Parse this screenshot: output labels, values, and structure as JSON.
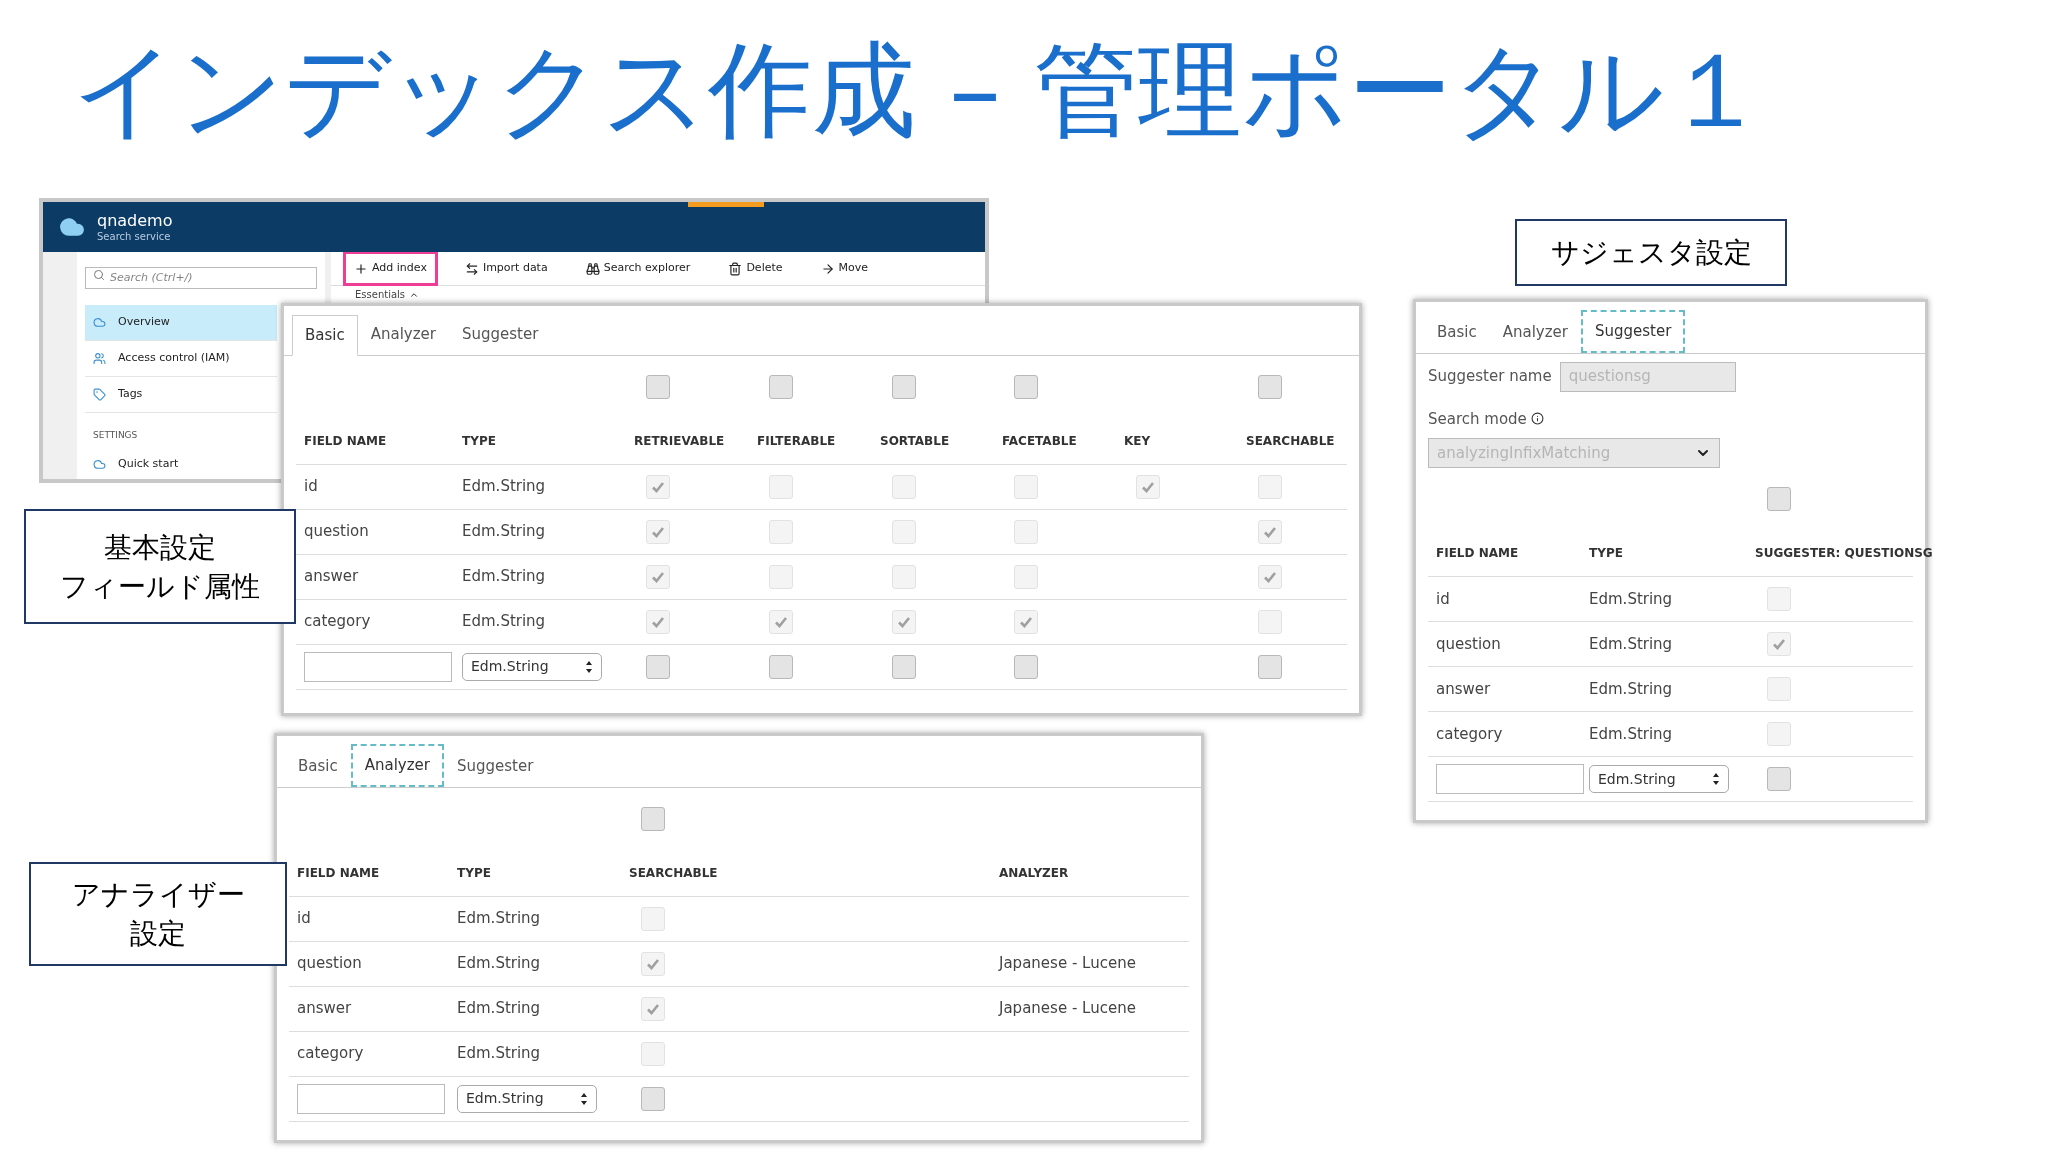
{
  "title": "インデックス作成 – 管理ポータル１",
  "portal": {
    "service_name": "qnademo",
    "service_type": "Search service",
    "search": {
      "placeholder": "Search (Ctrl+/)"
    },
    "busy": true,
    "sidebar": {
      "items": [
        {
          "label": "Overview",
          "selected": true
        },
        {
          "label": "Access control (IAM)",
          "selected": false
        },
        {
          "label": "Tags",
          "selected": false
        }
      ],
      "section": "SETTINGS",
      "section_items": [
        {
          "label": "Quick start",
          "selected": false
        }
      ]
    },
    "toolbar": [
      {
        "label": "Add index",
        "highlighted": true
      },
      {
        "label": "Import data",
        "highlighted": false
      },
      {
        "label": "Search explorer",
        "highlighted": false
      },
      {
        "label": "Delete",
        "highlighted": false
      },
      {
        "label": "Move",
        "highlighted": false
      }
    ],
    "essentials": "Essentials"
  },
  "callouts": [
    {
      "lines": [
        "基本設定",
        "フィールド属性"
      ]
    },
    {
      "lines": [
        "アナライザー",
        "設定"
      ]
    },
    {
      "lines": [
        "サジェスタ設定"
      ]
    }
  ],
  "panels": [
    {
      "kind": "basic",
      "tabs": [
        {
          "label": "Basic",
          "selected": true,
          "focus_ring": false
        },
        {
          "label": "Analyzer",
          "selected": false,
          "focus_ring": false
        },
        {
          "label": "Suggester",
          "selected": false,
          "focus_ring": false
        }
      ],
      "columns": [
        {
          "label": "FIELD NAME"
        },
        {
          "label": "TYPE"
        },
        {
          "label": "RETRIEVABLE",
          "select_all": {
            "checked": false
          }
        },
        {
          "label": "FILTERABLE",
          "select_all": {
            "checked": false
          }
        },
        {
          "label": "SORTABLE",
          "select_all": {
            "checked": false
          }
        },
        {
          "label": "FACETABLE",
          "select_all": {
            "checked": false
          }
        },
        {
          "label": "KEY"
        },
        {
          "label": "SEARCHABLE",
          "select_all": {
            "checked": false
          }
        }
      ],
      "rows": [
        [
          {
            "kind": "text",
            "text": "id"
          },
          {
            "kind": "text",
            "text": "Edm.String"
          },
          {
            "kind": "check",
            "checked": true,
            "disabled": true
          },
          {
            "kind": "check",
            "checked": false,
            "disabled": true
          },
          {
            "kind": "check",
            "checked": false,
            "disabled": true
          },
          {
            "kind": "check",
            "checked": false,
            "disabled": true
          },
          {
            "kind": "check",
            "checked": true,
            "disabled": true
          },
          {
            "kind": "check",
            "checked": false,
            "disabled": true
          }
        ],
        [
          {
            "kind": "text",
            "text": "question"
          },
          {
            "kind": "text",
            "text": "Edm.String"
          },
          {
            "kind": "check",
            "checked": true,
            "disabled": true
          },
          {
            "kind": "check",
            "checked": false,
            "disabled": true
          },
          {
            "kind": "check",
            "checked": false,
            "disabled": true
          },
          {
            "kind": "check",
            "checked": false,
            "disabled": true
          },
          null,
          {
            "kind": "check",
            "checked": true,
            "disabled": true
          }
        ],
        [
          {
            "kind": "text",
            "text": "answer"
          },
          {
            "kind": "text",
            "text": "Edm.String"
          },
          {
            "kind": "check",
            "checked": true,
            "disabled": true
          },
          {
            "kind": "check",
            "checked": false,
            "disabled": true
          },
          {
            "kind": "check",
            "checked": false,
            "disabled": true
          },
          {
            "kind": "check",
            "checked": false,
            "disabled": true
          },
          null,
          {
            "kind": "check",
            "checked": true,
            "disabled": true
          }
        ],
        [
          {
            "kind": "text",
            "text": "category"
          },
          {
            "kind": "text",
            "text": "Edm.String"
          },
          {
            "kind": "check",
            "checked": true,
            "disabled": true
          },
          {
            "kind": "check",
            "checked": true,
            "disabled": true
          },
          {
            "kind": "check",
            "checked": true,
            "disabled": true
          },
          {
            "kind": "check",
            "checked": true,
            "disabled": true
          },
          null,
          {
            "kind": "check",
            "checked": false,
            "disabled": true
          }
        ],
        [
          {
            "kind": "input"
          },
          {
            "kind": "select",
            "value": "Edm.String"
          },
          {
            "kind": "check",
            "checked": false,
            "disabled": false
          },
          {
            "kind": "check",
            "checked": false,
            "disabled": false
          },
          {
            "kind": "check",
            "checked": false,
            "disabled": false
          },
          {
            "kind": "check",
            "checked": false,
            "disabled": false
          },
          null,
          {
            "kind": "check",
            "checked": false,
            "disabled": false
          }
        ]
      ]
    },
    {
      "kind": "analyzer",
      "tabs": [
        {
          "label": "Basic",
          "selected": false,
          "focus_ring": false
        },
        {
          "label": "Analyzer",
          "selected": true,
          "focus_ring": true
        },
        {
          "label": "Suggester",
          "selected": false,
          "focus_ring": false
        }
      ],
      "columns": [
        {
          "label": "FIELD NAME"
        },
        {
          "label": "TYPE"
        },
        {
          "label": "SEARCHABLE",
          "select_all": {
            "checked": false
          }
        },
        {
          "label": "ANALYZER"
        }
      ],
      "rows": [
        [
          {
            "kind": "text",
            "text": "id"
          },
          {
            "kind": "text",
            "text": "Edm.String"
          },
          {
            "kind": "check",
            "checked": false,
            "disabled": true
          },
          null
        ],
        [
          {
            "kind": "text",
            "text": "question"
          },
          {
            "kind": "text",
            "text": "Edm.String"
          },
          {
            "kind": "check",
            "checked": true,
            "disabled": true
          },
          {
            "kind": "text",
            "text": "Japanese - Lucene"
          }
        ],
        [
          {
            "kind": "text",
            "text": "answer"
          },
          {
            "kind": "text",
            "text": "Edm.String"
          },
          {
            "kind": "check",
            "checked": true,
            "disabled": true
          },
          {
            "kind": "text",
            "text": "Japanese - Lucene"
          }
        ],
        [
          {
            "kind": "text",
            "text": "category"
          },
          {
            "kind": "text",
            "text": "Edm.String"
          },
          {
            "kind": "check",
            "checked": false,
            "disabled": true
          },
          null
        ],
        [
          {
            "kind": "input"
          },
          {
            "kind": "select",
            "value": "Edm.String"
          },
          {
            "kind": "check",
            "checked": false,
            "disabled": false
          },
          null
        ]
      ]
    },
    {
      "kind": "suggester",
      "tabs": [
        {
          "label": "Basic",
          "selected": false,
          "focus_ring": false
        },
        {
          "label": "Analyzer",
          "selected": false,
          "focus_ring": false
        },
        {
          "label": "Suggester",
          "selected": true,
          "focus_ring": true
        }
      ],
      "suggester_name": {
        "label": "Suggester name",
        "value": "questionsg",
        "disabled": true
      },
      "search_mode": {
        "label": "Search mode",
        "value": "analyzingInfixMatching",
        "disabled": true
      },
      "columns": [
        {
          "label": "FIELD NAME"
        },
        {
          "label": "TYPE"
        },
        {
          "label": "SUGGESTER: QUESTIONSG",
          "select_all": {
            "checked": false
          }
        }
      ],
      "rows": [
        [
          {
            "kind": "text",
            "text": "id"
          },
          {
            "kind": "text",
            "text": "Edm.String"
          },
          {
            "kind": "check",
            "checked": false,
            "disabled": true
          }
        ],
        [
          {
            "kind": "text",
            "text": "question"
          },
          {
            "kind": "text",
            "text": "Edm.String"
          },
          {
            "kind": "check",
            "checked": true,
            "disabled": true
          }
        ],
        [
          {
            "kind": "text",
            "text": "answer"
          },
          {
            "kind": "text",
            "text": "Edm.String"
          },
          {
            "kind": "check",
            "checked": false,
            "disabled": true
          }
        ],
        [
          {
            "kind": "text",
            "text": "category"
          },
          {
            "kind": "text",
            "text": "Edm.String"
          },
          {
            "kind": "check",
            "checked": false,
            "disabled": true
          }
        ],
        [
          {
            "kind": "input"
          },
          {
            "kind": "select",
            "value": "Edm.String"
          },
          {
            "kind": "check",
            "checked": false,
            "disabled": false
          }
        ]
      ]
    }
  ]
}
